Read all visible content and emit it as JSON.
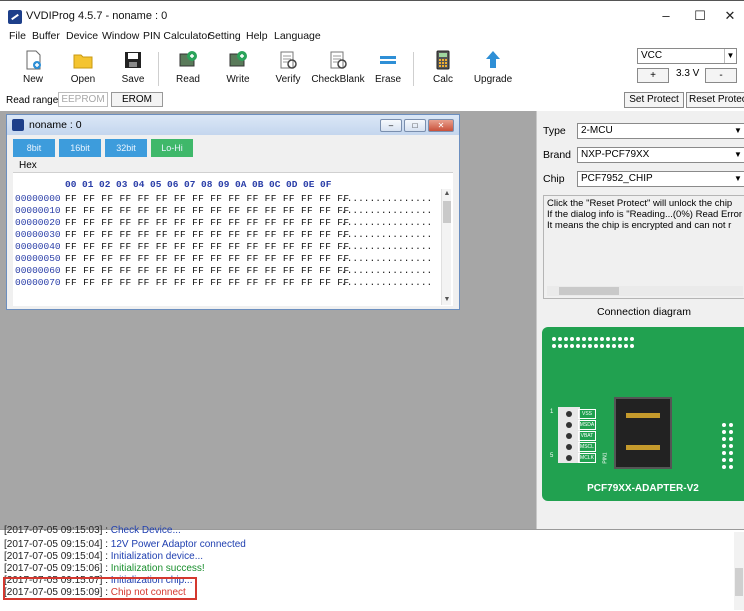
{
  "window": {
    "title": "VVDIProg 4.5.7 - noname : 0"
  },
  "menu": [
    "File",
    "Buffer",
    "Device",
    "Window",
    "PIN Calculator",
    "Setting",
    "Help",
    "Language"
  ],
  "toolbar": {
    "buttons": [
      {
        "label": "New",
        "icon": "new-file-icon"
      },
      {
        "label": "Open",
        "icon": "folder-icon"
      },
      {
        "label": "Save",
        "icon": "floppy-icon"
      },
      {
        "label": "Read",
        "icon": "read-chip-icon"
      },
      {
        "label": "Write",
        "icon": "write-chip-icon"
      },
      {
        "label": "Verify",
        "icon": "verify-icon"
      },
      {
        "label": "CheckBlank",
        "icon": "checkblank-icon"
      },
      {
        "label": "Erase",
        "icon": "erase-icon"
      },
      {
        "label": "Calc",
        "icon": "calculator-icon"
      },
      {
        "label": "Upgrade",
        "icon": "upgrade-arrow-icon"
      }
    ],
    "vcc": {
      "selected": "VCC",
      "plus": "+",
      "minus": "-",
      "voltage": "3.3 V"
    }
  },
  "read_range": {
    "label": "Read range",
    "eeprom": "EEPROM",
    "erom": "EROM"
  },
  "protect": {
    "set": "Set Protect",
    "reset": "Reset Protect"
  },
  "buffer_window": {
    "title": "noname : 0",
    "tabs": [
      "8bit",
      "16bit",
      "32bit",
      "Lo-Hi"
    ],
    "section": "Hex",
    "columns": [
      "00",
      "01",
      "02",
      "03",
      "04",
      "05",
      "06",
      "07",
      "08",
      "09",
      "0A",
      "0B",
      "0C",
      "0D",
      "0E",
      "0F"
    ],
    "rows": [
      {
        "addr": "00000000",
        "bytes": "FF FF FF FF FF FF FF FF FF FF FF FF FF FF FF FF",
        "ascii": "................"
      },
      {
        "addr": "00000010",
        "bytes": "FF FF FF FF FF FF FF FF FF FF FF FF FF FF FF FF",
        "ascii": "................"
      },
      {
        "addr": "00000020",
        "bytes": "FF FF FF FF FF FF FF FF FF FF FF FF FF FF FF FF",
        "ascii": "................"
      },
      {
        "addr": "00000030",
        "bytes": "FF FF FF FF FF FF FF FF FF FF FF FF FF FF FF FF",
        "ascii": "................"
      },
      {
        "addr": "00000040",
        "bytes": "FF FF FF FF FF FF FF FF FF FF FF FF FF FF FF FF",
        "ascii": "................"
      },
      {
        "addr": "00000050",
        "bytes": "FF FF FF FF FF FF FF FF FF FF FF FF FF FF FF FF",
        "ascii": "................"
      },
      {
        "addr": "00000060",
        "bytes": "FF FF FF FF FF FF FF FF FF FF FF FF FF FF FF FF",
        "ascii": "................"
      },
      {
        "addr": "00000070",
        "bytes": "FF FF FF FF FF FF FF FF FF FF FF FF FF FF FF FF",
        "ascii": "................"
      }
    ]
  },
  "device": {
    "type_label": "Type",
    "type": "2-MCU",
    "brand_label": "Brand",
    "brand": "NXP-PCF79XX",
    "chip_label": "Chip",
    "chip": "PCF7952_CHIP",
    "info": [
      "Click the \"Reset Protect\" will unlock the chip",
      "If the dialog info is \"Reading...(0%) Read Error",
      "It means the chip is encrypted and can not r"
    ],
    "connection_label": "Connection diagram",
    "adapter_name": "PCF79XX-ADAPTER-V2",
    "pin_labels": [
      "VSS",
      "MSDA",
      "VBAT",
      "MSCL",
      "MCLK"
    ],
    "pin_side_labels": [
      "1",
      "5",
      "PIN1"
    ]
  },
  "log": [
    {
      "ts": "[2017-07-05 09:15:03]",
      "msg": "Check Device...",
      "color": "#1f3fb0"
    },
    {
      "ts": "[2017-07-05 09:15:04]",
      "msg": "12V Power Adaptor connected",
      "color": "#1f3fb0"
    },
    {
      "ts": "[2017-07-05 09:15:04]",
      "msg": "Initialization device...",
      "color": "#1f3fb0"
    },
    {
      "ts": "[2017-07-05 09:15:06]",
      "msg": "Initialization success!",
      "color": "#1a8f2e"
    },
    {
      "ts": "[2017-07-05 09:15:07]",
      "msg": "Initialization chip...",
      "color": "#1f3fb0"
    },
    {
      "ts": "[2017-07-05 09:15:09]",
      "msg": "Chip not connect",
      "color": "#d4382f"
    }
  ]
}
